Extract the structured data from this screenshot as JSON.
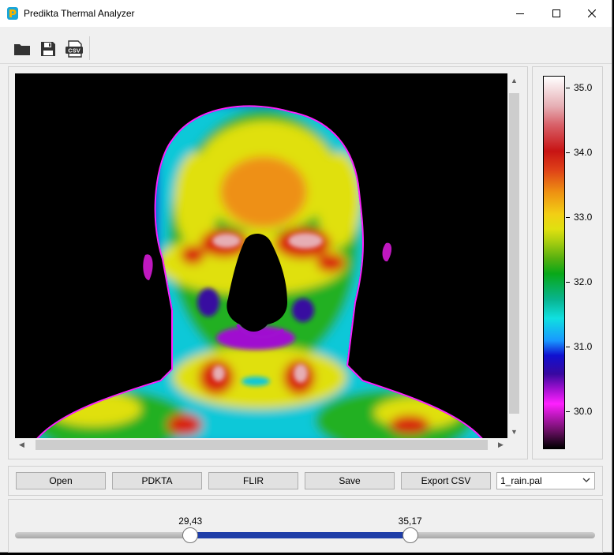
{
  "window": {
    "title": "Predikta Thermal Analyzer",
    "logo_letter": "P",
    "controls": [
      "minimize-icon",
      "maximize-icon",
      "close-icon"
    ]
  },
  "toolbar": {
    "items": [
      {
        "name": "open-folder-icon"
      },
      {
        "name": "save-disk-icon"
      },
      {
        "name": "export-csv-icon",
        "label": "CSV"
      }
    ]
  },
  "thermal_image": {
    "subject": "thermal image of a face",
    "palette_colors": [
      "#000000",
      "#ff20ff",
      "#1010d0",
      "#10e0e0",
      "#08a818",
      "#e0e010",
      "#ee9012",
      "#c81414",
      "#e6aeb4",
      "#ffffff"
    ]
  },
  "scale": {
    "labels": [
      "35.0",
      "34.0",
      "33.0",
      "32.0",
      "31.0",
      "30.0"
    ]
  },
  "buttons": {
    "open": "Open",
    "pdkta": "PDKTA",
    "flir": "FLIR",
    "save": "Save",
    "export_csv": "Export CSV"
  },
  "palette_select": {
    "value": "1_rain.pal"
  },
  "range": {
    "low_label": "29,43",
    "high_label": "35,17",
    "low": 29.43,
    "high": 35.17,
    "accent": "#1f3ea8"
  }
}
